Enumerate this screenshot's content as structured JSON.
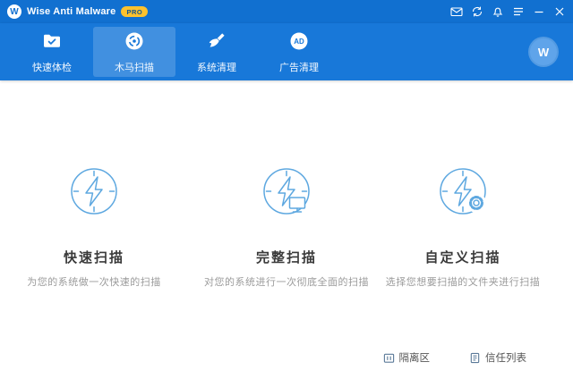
{
  "titlebar": {
    "app_name": "Wise Anti Malware",
    "badge": "PRO",
    "logo_letter": "W"
  },
  "nav": {
    "tabs": [
      {
        "label": "快速体检",
        "icon": "folder-check-icon",
        "active": false
      },
      {
        "label": "木马扫描",
        "icon": "scan-disc-icon",
        "active": true
      },
      {
        "label": "系统清理",
        "icon": "broom-icon",
        "active": false
      },
      {
        "label": "广告清理",
        "icon": "ad-circle-icon",
        "active": false
      }
    ],
    "avatar_letter": "W"
  },
  "scans": [
    {
      "title": "快速扫描",
      "subtitle": "为您的系统做一次快速的扫描",
      "icon": "quick-scan-bolt-icon"
    },
    {
      "title": "完整扫描",
      "subtitle": "对您的系统进行一次彻底全面的扫描",
      "icon": "full-scan-monitor-icon"
    },
    {
      "title": "自定义扫描",
      "subtitle": "选择您想要扫描的文件夹进行扫描",
      "icon": "custom-scan-gear-icon"
    }
  ],
  "footer": {
    "quarantine_label": "隔离区",
    "trust_label": "信任列表"
  },
  "colors": {
    "titlebar_blue": "#1170d0",
    "nav_blue": "#1878d9",
    "badge_yellow": "#ffc22d",
    "scan_icon_blue": "#5ea8e0",
    "title_text": "#3a3a3a",
    "subtitle_text": "#9b9b9b"
  }
}
